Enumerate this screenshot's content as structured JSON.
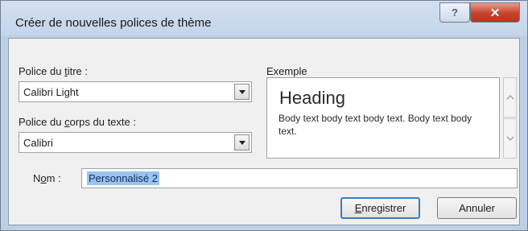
{
  "window": {
    "title": "Créer de nouvelles polices de thème"
  },
  "title_buttons": {
    "help": "?",
    "close": "✕"
  },
  "heading_font": {
    "label_pre": "Police du ",
    "label_key": "t",
    "label_post": "itre :",
    "value": "Calibri Light"
  },
  "body_font": {
    "label_pre": "Police du ",
    "label_key": "c",
    "label_post": "orps du texte :",
    "value": "Calibri"
  },
  "sample": {
    "label": "Exemple",
    "heading": "Heading",
    "body": "Body text body text body text. Body text body text."
  },
  "name": {
    "label_pre": "N",
    "label_key": "o",
    "label_post": "m :",
    "value": "Personnalisé 2"
  },
  "buttons": {
    "save_key": "E",
    "save_rest": "nregistrer",
    "cancel": "Annuler"
  },
  "icons": {
    "help": "question-mark-icon",
    "close": "close-icon",
    "dropdown": "chevron-down-icon",
    "scroll_up": "chevron-up-icon",
    "scroll_down": "chevron-down-icon"
  },
  "colors": {
    "frame": "#bfcfe3",
    "client": "#f0f0f0",
    "close_button": "#c7432c",
    "selection": "#9bc3ec",
    "default_button_border": "#3d7bbf"
  }
}
